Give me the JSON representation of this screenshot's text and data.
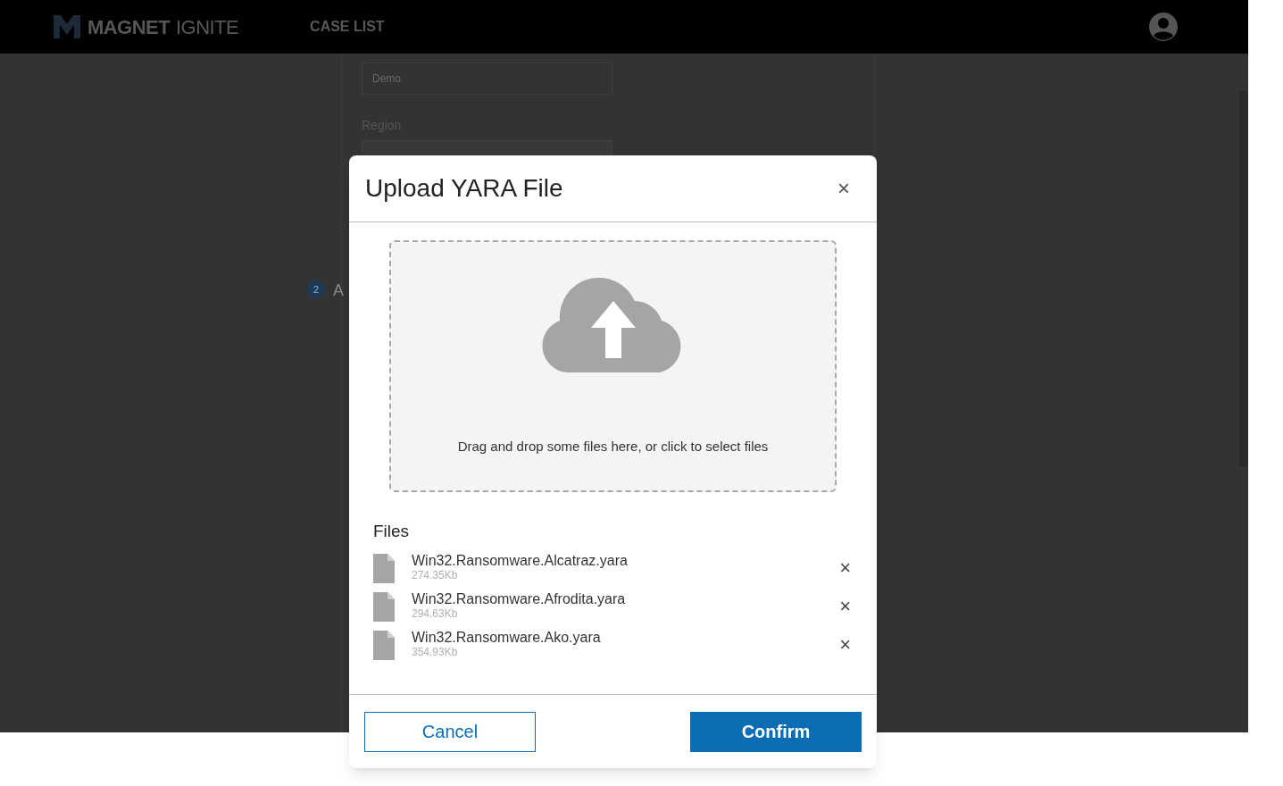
{
  "header": {
    "brand_bold": "MAGNET",
    "brand_light": "IGNITE",
    "nav": "CASE LIST"
  },
  "background_form": {
    "case_field_value": "Demo",
    "region_label": "Region",
    "step_number": "2",
    "step_label": "A"
  },
  "dialog": {
    "title": "Upload YARA File",
    "close": "×",
    "dropzone_text": "Drag and drop some files here, or click to select files",
    "files_heading": "Files",
    "files": [
      {
        "name": "Win32.Ransomware.Alcatraz.yara",
        "size": "274.35Kb"
      },
      {
        "name": "Win32.Ransomware.Afrodita.yara",
        "size": "294.63Kb"
      },
      {
        "name": "Win32.Ransomware.Ako.yara",
        "size": "354.93Kb"
      }
    ],
    "buttons": [
      {
        "label": "Cancel",
        "kind": "secondary"
      },
      {
        "label": "Confirm",
        "kind": "primary"
      }
    ]
  }
}
